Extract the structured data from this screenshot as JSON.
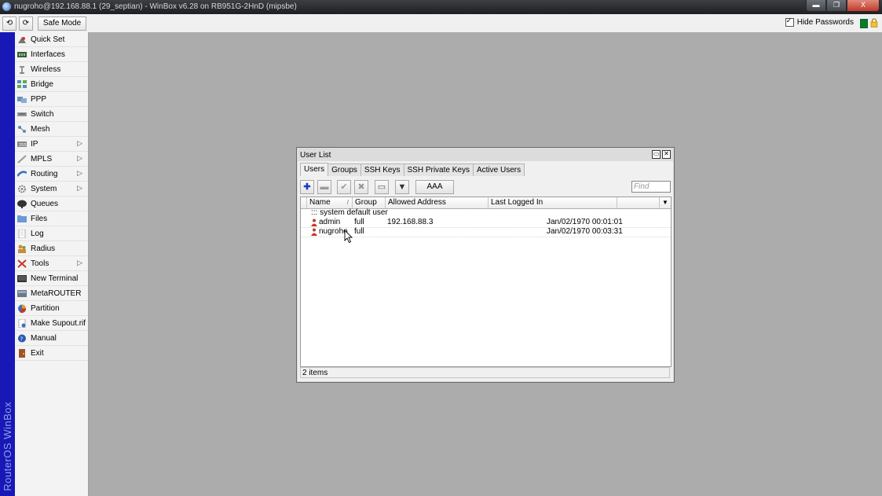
{
  "window": {
    "title": "nugroho@192.168.88.1 (29_septian) - WinBox v6.28 on RB951G-2HnD (mipsbe)",
    "controls": {
      "minimize": "▬",
      "maximize": "❐",
      "close": "X"
    }
  },
  "toolbar": {
    "undo_icon": "⟲",
    "redo_icon": "⟳",
    "safe_mode_label": "Safe Mode",
    "hide_passwords_label": "Hide Passwords",
    "hide_passwords_checked": true
  },
  "brand": "RouterOS WinBox",
  "sidebar": {
    "items": [
      {
        "label": "Quick Set",
        "icon": "quick-set-icon",
        "submenu": false
      },
      {
        "label": "Interfaces",
        "icon": "interfaces-icon",
        "submenu": false
      },
      {
        "label": "Wireless",
        "icon": "wireless-icon",
        "submenu": false
      },
      {
        "label": "Bridge",
        "icon": "bridge-icon",
        "submenu": false
      },
      {
        "label": "PPP",
        "icon": "ppp-icon",
        "submenu": false
      },
      {
        "label": "Switch",
        "icon": "switch-icon",
        "submenu": false
      },
      {
        "label": "Mesh",
        "icon": "mesh-icon",
        "submenu": false
      },
      {
        "label": "IP",
        "icon": "ip-icon",
        "submenu": true
      },
      {
        "label": "MPLS",
        "icon": "mpls-icon",
        "submenu": true
      },
      {
        "label": "Routing",
        "icon": "routing-icon",
        "submenu": true
      },
      {
        "label": "System",
        "icon": "system-icon",
        "submenu": true
      },
      {
        "label": "Queues",
        "icon": "queues-icon",
        "submenu": false
      },
      {
        "label": "Files",
        "icon": "files-icon",
        "submenu": false
      },
      {
        "label": "Log",
        "icon": "log-icon",
        "submenu": false
      },
      {
        "label": "Radius",
        "icon": "radius-icon",
        "submenu": false
      },
      {
        "label": "Tools",
        "icon": "tools-icon",
        "submenu": true
      },
      {
        "label": "New Terminal",
        "icon": "terminal-icon",
        "submenu": false
      },
      {
        "label": "MetaROUTER",
        "icon": "metarouter-icon",
        "submenu": false
      },
      {
        "label": "Partition",
        "icon": "partition-icon",
        "submenu": false
      },
      {
        "label": "Make Supout.rif",
        "icon": "supout-icon",
        "submenu": false
      },
      {
        "label": "Manual",
        "icon": "manual-icon",
        "submenu": false
      },
      {
        "label": "Exit",
        "icon": "exit-icon",
        "submenu": false
      }
    ],
    "submenu_glyph": "▷"
  },
  "user_list": {
    "title": "User List",
    "tabs": [
      "Users",
      "Groups",
      "SSH Keys",
      "SSH Private Keys",
      "Active Users"
    ],
    "active_tab": "Users",
    "buttons": {
      "add": "✚",
      "remove": "▬",
      "enable": "✔",
      "disable": "✖",
      "comment": "▭",
      "filter": "▼",
      "aaa_label": "AAA"
    },
    "find_placeholder": "Find",
    "columns": [
      "Name",
      "Group",
      "Allowed Address",
      "Last Logged In"
    ],
    "sort_mark": "/",
    "comment": "::: system default user",
    "rows": [
      {
        "name": "admin",
        "group": "full",
        "allowed_address": "192.168.88.3",
        "last_logged_in": "Jan/02/1970 00:01:01"
      },
      {
        "name": "nugroho",
        "group": "full",
        "allowed_address": "",
        "last_logged_in": "Jan/02/1970 00:03:31"
      }
    ],
    "status": "2 items"
  }
}
